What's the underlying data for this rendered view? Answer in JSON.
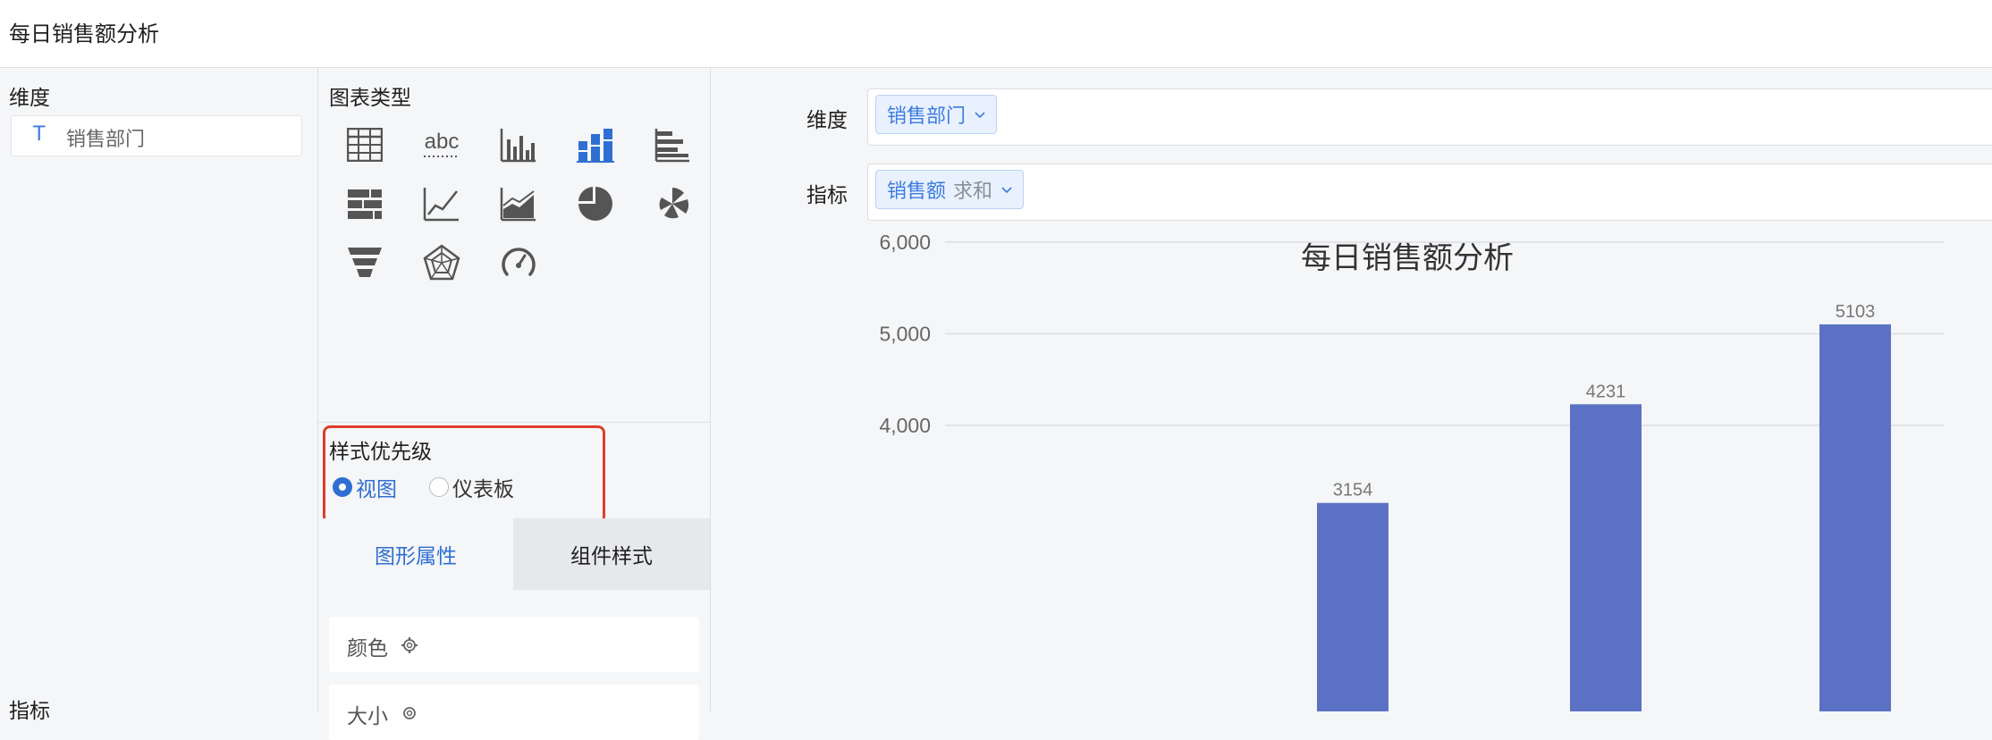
{
  "header": {
    "title": "每日销售额分析"
  },
  "left_panel": {
    "dimension_label": "维度",
    "dimension_field": {
      "type_icon": "T",
      "label": "销售部门"
    },
    "metric_label": "指标"
  },
  "mid_panel": {
    "chart_type_label": "图表类型",
    "chart_types": [
      {
        "name": "table-icon"
      },
      {
        "name": "text-abc-icon",
        "text": "abc"
      },
      {
        "name": "bar-chart-icon"
      },
      {
        "name": "stacked-bar-icon"
      },
      {
        "name": "horizontal-bar-icon"
      },
      {
        "name": "stacked-horizontal-bar-icon"
      },
      {
        "name": "line-chart-icon"
      },
      {
        "name": "area-chart-icon"
      },
      {
        "name": "pie-chart-icon"
      },
      {
        "name": "rose-chart-icon"
      },
      {
        "name": "funnel-icon"
      },
      {
        "name": "radar-icon"
      },
      {
        "name": "gauge-icon"
      }
    ],
    "style_priority": {
      "label": "样式优先级",
      "options": [
        {
          "label": "视图",
          "selected": true
        },
        {
          "label": "仪表板",
          "selected": false
        }
      ]
    },
    "tabs": [
      {
        "label": "图形属性",
        "active": true
      },
      {
        "label": "组件样式",
        "active": false
      }
    ],
    "props": [
      {
        "label": "颜色"
      },
      {
        "label": "大小"
      }
    ]
  },
  "main": {
    "shelves": [
      {
        "label": "维度",
        "pill": "销售部门",
        "agg": ""
      },
      {
        "label": "指标",
        "pill": "销售额",
        "agg": "求和"
      }
    ]
  },
  "colors": {
    "accent": "#3d7be0",
    "bar": "#5b72c4",
    "highlight": "#e03c2b"
  },
  "chart_data": {
    "type": "bar",
    "title": "每日销售额分析",
    "y_ticks": [
      "6,000",
      "5,000",
      "4,000"
    ],
    "visible_ylim": [
      3200,
      6000
    ],
    "series": [
      {
        "values": [
          3154,
          4231,
          5103
        ]
      }
    ],
    "data_labels": [
      "3154",
      "4231",
      "5103"
    ]
  }
}
